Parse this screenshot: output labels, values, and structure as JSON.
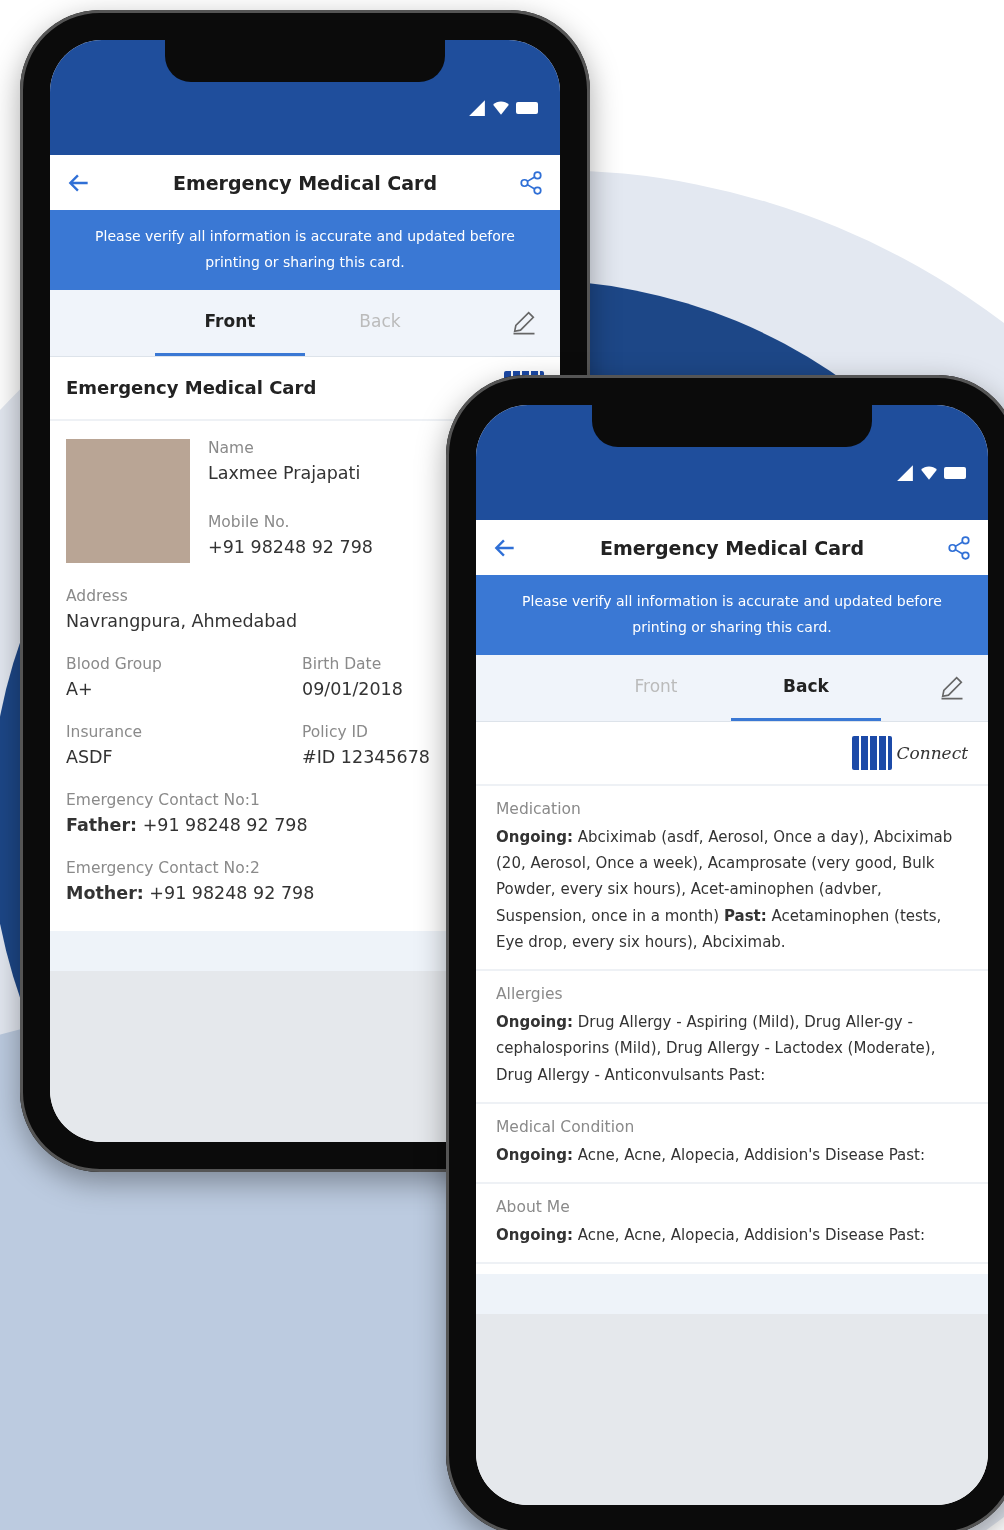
{
  "front_phone": {
    "app_bar": {
      "title": "Emergency Medical Card"
    },
    "notice": "Please verify all information is accurate and updated before printing or sharing this card.",
    "tabs": [
      {
        "label": "Front",
        "selected": true
      },
      {
        "label": "Back",
        "selected": false
      }
    ],
    "card": {
      "title": "Emergency Medical Card",
      "profile": [
        {
          "label": "Name",
          "value": "Laxmee Prajapati"
        },
        {
          "label": "Mobile No.",
          "value": "+91 98248 92 798"
        }
      ],
      "fields": [
        {
          "label": "Address",
          "value": "Navrangpura, Ahmedabad",
          "wide": true
        },
        {
          "label": "Blood Group",
          "value": "A+",
          "wide": false
        },
        {
          "label": "Birth Date",
          "value": "09/01/2018",
          "wide": false
        },
        {
          "label": "Insurance",
          "value": "ASDF",
          "wide": false
        },
        {
          "label": "Policy ID",
          "value": "#ID 12345678",
          "wide": false
        }
      ],
      "contacts": [
        {
          "label": "Emergency Contact No:1",
          "value": "**Father:** +91 98248 92 798"
        },
        {
          "label": "Emergency Contact No:2",
          "value": "**Mother:** +91 98248 92 798"
        }
      ]
    }
  },
  "back_phone": {
    "app_bar": {
      "title": "Emergency Medical Card"
    },
    "notice": "Please verify all information is accurate and updated before printing or sharing this card.",
    "tabs": [
      {
        "label": "Front",
        "selected": false
      },
      {
        "label": "Back",
        "selected": true
      }
    ],
    "logo_text": "Connect",
    "sections": [
      {
        "title": "Medication",
        "body": "**Ongoing:** Abciximab (asdf, Aerosol, Once a day), Abciximab (20, Aerosol, Once a week), Acamprosate (very good, Bulk Powder, every six hours), Acet-aminophen (advber, Suspension, once in a month) **Past:** Acetaminophen (tests, Eye drop, every six hours), Abciximab."
      },
      {
        "title": "Allergies",
        "body": "**Ongoing:** Drug Allergy - Aspiring (Mild), Drug Aller-gy - cephalosporins (Mild), Drug Allergy - Lactodex (Moderate), Drug Allergy - Anticonvulsants Past:"
      },
      {
        "title": "Medical Condition",
        "body": "**Ongoing:** Acne, Acne, Alopecia, Addision's Disease Past:"
      },
      {
        "title": "About Me",
        "body": "**Ongoing:** Acne, Acne, Alopecia, Addision's Disease Past:"
      }
    ]
  }
}
